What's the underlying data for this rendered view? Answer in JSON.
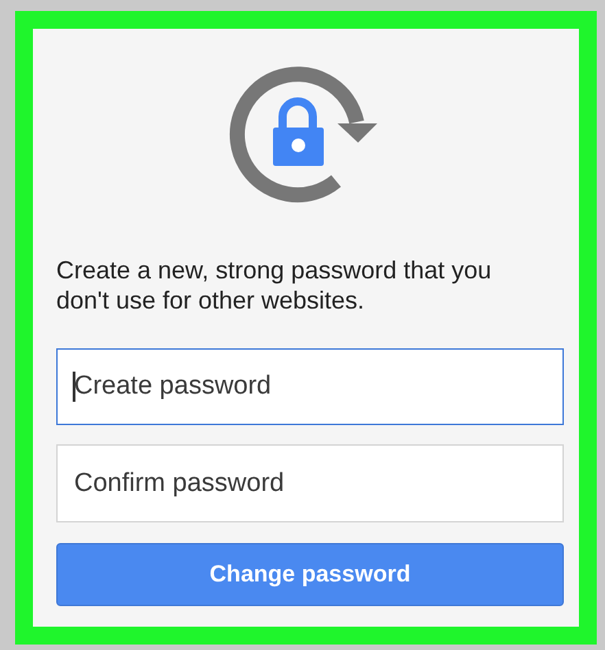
{
  "message": "Create a new, strong password that you don't use for other websites.",
  "fields": [
    {
      "placeholder": "Create password",
      "focused": true
    },
    {
      "placeholder": "Confirm password",
      "focused": false
    }
  ],
  "button": {
    "label": "Change password"
  }
}
